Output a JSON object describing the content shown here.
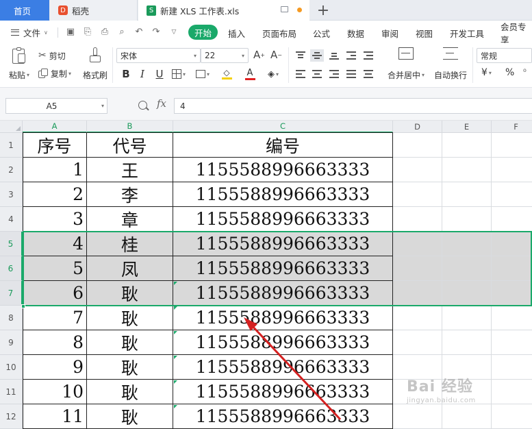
{
  "tabs": {
    "home": "首页",
    "docer": "稻壳",
    "file": "新建 XLS 工作表.xls"
  },
  "menu": {
    "file_label": "文件",
    "items": [
      "开始",
      "插入",
      "页面布局",
      "公式",
      "数据",
      "审阅",
      "视图",
      "开发工具",
      "会员专享"
    ]
  },
  "ribbon": {
    "paste": "粘贴",
    "cut": "剪切",
    "copy": "复制",
    "format_painter": "格式刷",
    "font_name": "宋体",
    "font_size": "22",
    "merge_center": "合并居中",
    "wrap_text": "自动换行",
    "number_format": "常规",
    "currency_symbol": "¥",
    "percent_symbol": "%"
  },
  "formula_bar": {
    "name_box": "A5",
    "fx": "fx",
    "value": "4"
  },
  "columns": [
    "A",
    "B",
    "C",
    "D",
    "E",
    "F"
  ],
  "rows": [
    "1",
    "2",
    "3",
    "4",
    "5",
    "6",
    "7",
    "8",
    "9",
    "10",
    "11",
    "12"
  ],
  "table": {
    "headers": [
      "序号",
      "代号",
      "编号"
    ],
    "rows": [
      [
        "1",
        "王",
        "1155588996663333"
      ],
      [
        "2",
        "李",
        "1155588996663333"
      ],
      [
        "3",
        "章",
        "1155588996663333"
      ],
      [
        "4",
        "桂",
        "1155588996663333"
      ],
      [
        "5",
        "凤",
        "1155588996663333"
      ],
      [
        "6",
        "耿",
        "1155588996663333"
      ],
      [
        "7",
        "耿",
        "1155588996663333"
      ],
      [
        "8",
        "耿",
        "1155588996663333"
      ],
      [
        "9",
        "耿",
        "1155588996663333"
      ],
      [
        "10",
        "耿",
        "1155588996663333"
      ],
      [
        "11",
        "耿",
        "1155588996663333"
      ]
    ]
  },
  "selection": {
    "rows": [
      "5",
      "6",
      "7"
    ],
    "accent_color": "#1aa96a",
    "fill_color": "#d9d9d9"
  },
  "annotation": {
    "arrow_color": "#d42020"
  },
  "watermark": {
    "main": "Bai 经验",
    "sub": "jingyan.baidu.com"
  },
  "colors": {
    "home_tab": "#3b7ee4",
    "active_menu": "#1aa96a",
    "font_color_bar": "#e02020",
    "highlight_bar": "#f5d000"
  }
}
